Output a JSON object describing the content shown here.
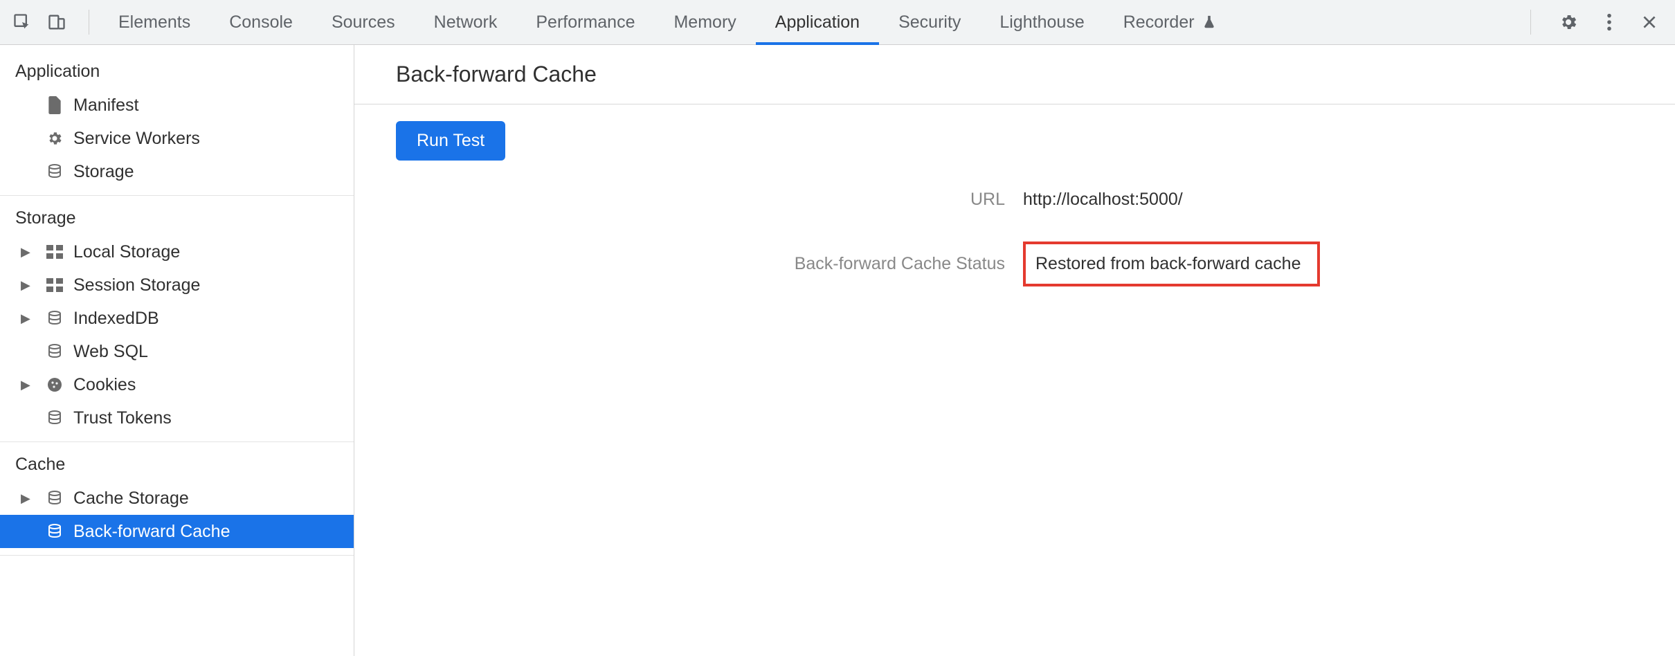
{
  "tabs": {
    "items": [
      {
        "label": "Elements"
      },
      {
        "label": "Console"
      },
      {
        "label": "Sources"
      },
      {
        "label": "Network"
      },
      {
        "label": "Performance"
      },
      {
        "label": "Memory"
      },
      {
        "label": "Application"
      },
      {
        "label": "Security"
      },
      {
        "label": "Lighthouse"
      },
      {
        "label": "Recorder"
      }
    ],
    "active_index": 6
  },
  "sidebar": {
    "sections": {
      "application": {
        "title": "Application",
        "items": [
          {
            "label": "Manifest"
          },
          {
            "label": "Service Workers"
          },
          {
            "label": "Storage"
          }
        ]
      },
      "storage": {
        "title": "Storage",
        "items": [
          {
            "label": "Local Storage"
          },
          {
            "label": "Session Storage"
          },
          {
            "label": "IndexedDB"
          },
          {
            "label": "Web SQL"
          },
          {
            "label": "Cookies"
          },
          {
            "label": "Trust Tokens"
          }
        ]
      },
      "cache": {
        "title": "Cache",
        "items": [
          {
            "label": "Cache Storage"
          },
          {
            "label": "Back-forward Cache"
          }
        ]
      }
    }
  },
  "main": {
    "title": "Back-forward Cache",
    "run_button": "Run Test",
    "rows": {
      "url_label": "URL",
      "url_value": "http://localhost:5000/",
      "status_label": "Back-forward Cache Status",
      "status_value": "Restored from back-forward cache"
    }
  }
}
